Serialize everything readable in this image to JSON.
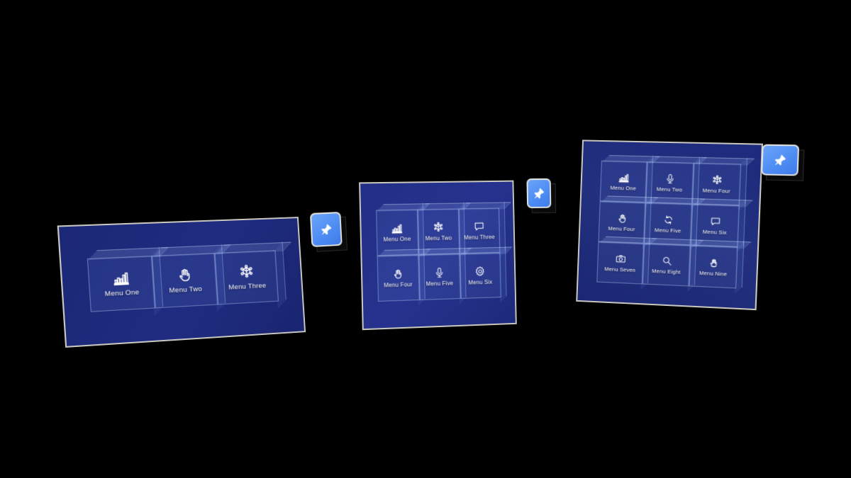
{
  "scene": {
    "background_color": "#000000",
    "panel_fill_color": "#1f2c80",
    "panel_border_color": "#c9c7c0",
    "cell_border_color": "#c8dcff",
    "pin_button_color": "#4f8ef4",
    "icon_color": "#ffffff"
  },
  "panels": [
    {
      "name": "menu-panel-one",
      "columns": 3,
      "rows": 1,
      "items": [
        {
          "label": "Menu One",
          "icon": "bar-chart-icon"
        },
        {
          "label": "Menu Two",
          "icon": "hand-icon"
        },
        {
          "label": "Menu Three",
          "icon": "cube-node-icon"
        }
      ],
      "pin": {
        "label": "Pin",
        "icon": "pushpin-icon"
      }
    },
    {
      "name": "menu-panel-two",
      "columns": 3,
      "rows": 2,
      "items": [
        {
          "label": "Menu One",
          "icon": "bar-chart-icon"
        },
        {
          "label": "Menu Two",
          "icon": "cube-node-icon"
        },
        {
          "label": "Menu Three",
          "icon": "chat-bubble-icon"
        },
        {
          "label": "Menu Four",
          "icon": "hand-icon"
        },
        {
          "label": "Menu Five",
          "icon": "microphone-icon"
        },
        {
          "label": "Menu Six",
          "icon": "gear-icon"
        }
      ],
      "pin": {
        "label": "Pin",
        "icon": "pushpin-icon"
      }
    },
    {
      "name": "menu-panel-three",
      "columns": 3,
      "rows": 3,
      "items": [
        {
          "label": "Menu One",
          "icon": "bar-chart-icon"
        },
        {
          "label": "Menu Two",
          "icon": "microphone-icon"
        },
        {
          "label": "Menu Four",
          "icon": "cube-node-icon"
        },
        {
          "label": "Menu Four",
          "icon": "hand-icon"
        },
        {
          "label": "Menu Five",
          "icon": "refresh-icon"
        },
        {
          "label": "Menu Six",
          "icon": "chat-bubble-icon"
        },
        {
          "label": "Menu Seven",
          "icon": "camera-icon"
        },
        {
          "label": "Menu Eight",
          "icon": "search-icon"
        },
        {
          "label": "Menu Nine",
          "icon": "open-hand-icon"
        }
      ],
      "pin": {
        "label": "Pin",
        "icon": "pushpin-icon"
      }
    }
  ]
}
